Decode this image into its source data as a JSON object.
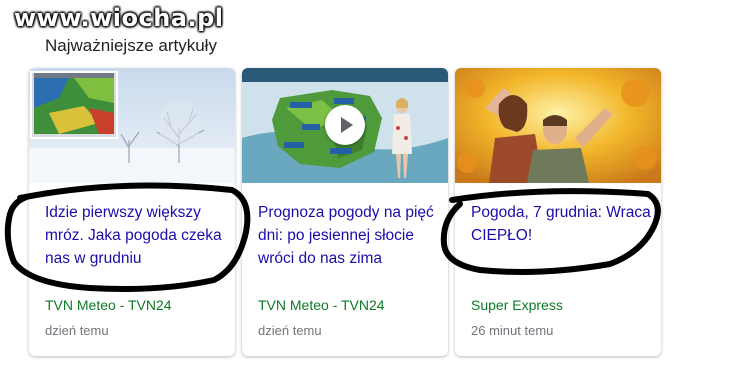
{
  "watermark": "www.wiocha.pl",
  "section_title": "Najważniejsze artykuły",
  "colors": {
    "link": "#1a0dab",
    "source": "#0d7a26",
    "meta": "#70757a"
  },
  "cards": [
    {
      "title": "Idzie pierwszy większy mróz. Jaka pogoda czeka nas w grudniu",
      "source": "TVN Meteo - TVN24",
      "time": "dzień temu",
      "thumbnail": "snowy-landscape-with-weather-map"
    },
    {
      "title": "Prognoza pogody na pięć dni: po jesiennej słocie wróci do nas zima",
      "source": "TVN Meteo - TVN24",
      "time": "dzień temu",
      "thumbnail": "weather-presenter-video",
      "video_icon": "play-icon"
    },
    {
      "title": "Pogoda, 7 grudnia: Wraca CIEPŁO!",
      "source": "Super Express",
      "time": "26 minut temu",
      "thumbnail": "happy-couple-autumn-leaves"
    }
  ]
}
